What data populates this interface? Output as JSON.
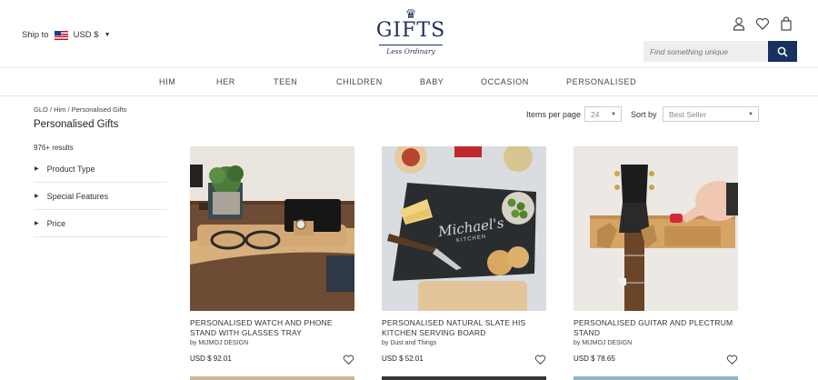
{
  "header": {
    "ship_label": "Ship to",
    "currency": "USD $",
    "logo": {
      "brand": "GIFTS",
      "tagline": "Less Ordinary"
    },
    "search_placeholder": "Find something unique",
    "icons": [
      "user-icon",
      "heart-icon",
      "bag-icon",
      "search-icon"
    ]
  },
  "nav": [
    "HIM",
    "HER",
    "TEEN",
    "CHILDREN",
    "BABY",
    "OCCASION",
    "PERSONALISED"
  ],
  "breadcrumb": "GLO /  Him /  Personalised Gifts",
  "page_title": "Personalised Gifts",
  "results": "976+ results",
  "filters": [
    "Product Type",
    "Special Features",
    "Price"
  ],
  "sorting": {
    "items_per_page_label": "Items per page",
    "items_per_page_value": "24",
    "sort_label": "Sort by",
    "sort_value": "Best Seller"
  },
  "products": [
    {
      "name": "PERSONALISED WATCH AND PHONE STAND WITH GLASSES TRAY",
      "by": "by MIJMOJ DESIGN",
      "price": "USD $ 92.01"
    },
    {
      "name": "PERSONALISED NATURAL SLATE HIS KITCHEN SERVING BOARD",
      "by": "by Dust and Things",
      "price": "USD $ 52.01"
    },
    {
      "name": "PERSONALISED GUITAR AND PLECTRUM STAND",
      "by": "by MIJMOJ DESIGN",
      "price": "USD $ 78.65"
    }
  ],
  "image_text": {
    "slate": "Michael's",
    "slate_sub": "KITCHEN"
  },
  "colors": {
    "accent": "#17305f",
    "border": "#e8e8e8"
  }
}
